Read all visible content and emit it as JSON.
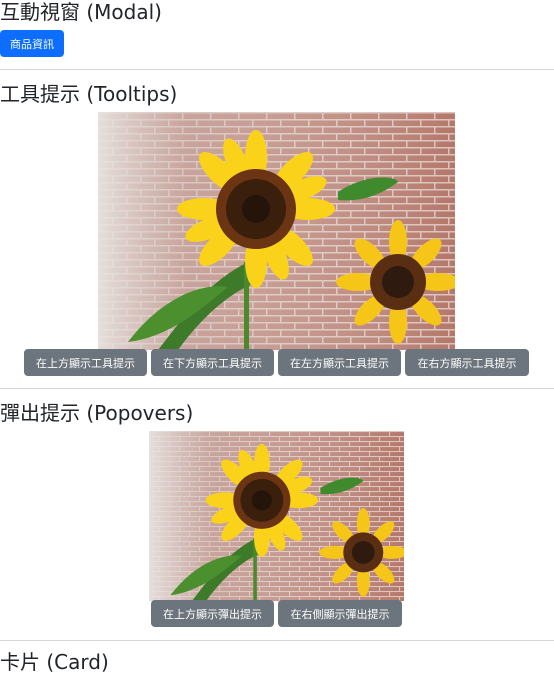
{
  "sections": {
    "modal": {
      "heading": "互動視窗 (Modal)",
      "button": "商品資訊"
    },
    "tooltips": {
      "heading": "工具提示 (Tooltips)",
      "buttons": [
        "在上方顯示工具提示",
        "在下方顯示工具提示",
        "在左方顯示工具提示",
        "在右方顯示工具提示"
      ]
    },
    "popovers": {
      "heading": "彈出提示 (Popovers)",
      "buttons": [
        "在上方顯示彈出提示",
        "在右側顯示彈出提示"
      ]
    },
    "card": {
      "heading": "卡片 (Card)"
    }
  },
  "colors": {
    "primary": "#0d6efd",
    "secondary": "#6c757d"
  }
}
